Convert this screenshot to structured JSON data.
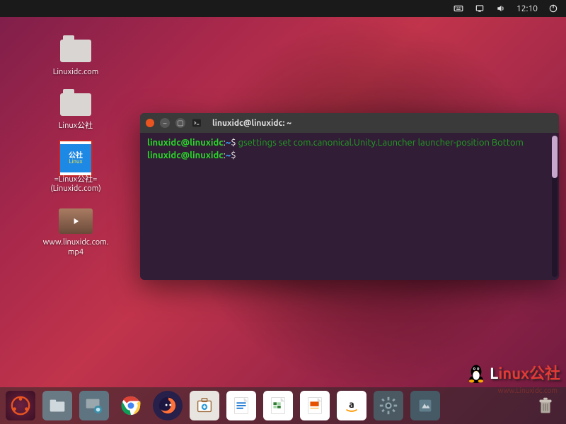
{
  "topbar": {
    "time": "12:10"
  },
  "desktop_icons": [
    {
      "label": "Linuxidc.com"
    },
    {
      "label": "Linux公社"
    },
    {
      "label": "=Linux公社=\n(Linuxidc.com)"
    },
    {
      "label": "www.linuxidc.com.\nmp4"
    }
  ],
  "terminal": {
    "title": "linuxidc@linuxidc: ~",
    "lines": {
      "p1_user": "linuxidc@linuxidc",
      "p1_sep": ":",
      "p1_path": "~",
      "p1_prompt": "$ ",
      "cmd1": "gsettings set com.canonical.Unity.Launcher launcher-position Bottom",
      "p2_user": "linuxidc@linuxidc",
      "p2_sep": ":",
      "p2_path": "~",
      "p2_prompt": "$ "
    }
  },
  "watermark": {
    "brand_first": "L",
    "brand_rest": "inux公社",
    "url": "www.Linuxidc.com"
  },
  "dock": {
    "items": [
      "show-applications",
      "files",
      "screenshot",
      "chrome",
      "firefox",
      "software-center",
      "writer",
      "calc",
      "impress",
      "amazon",
      "settings",
      "help"
    ]
  }
}
